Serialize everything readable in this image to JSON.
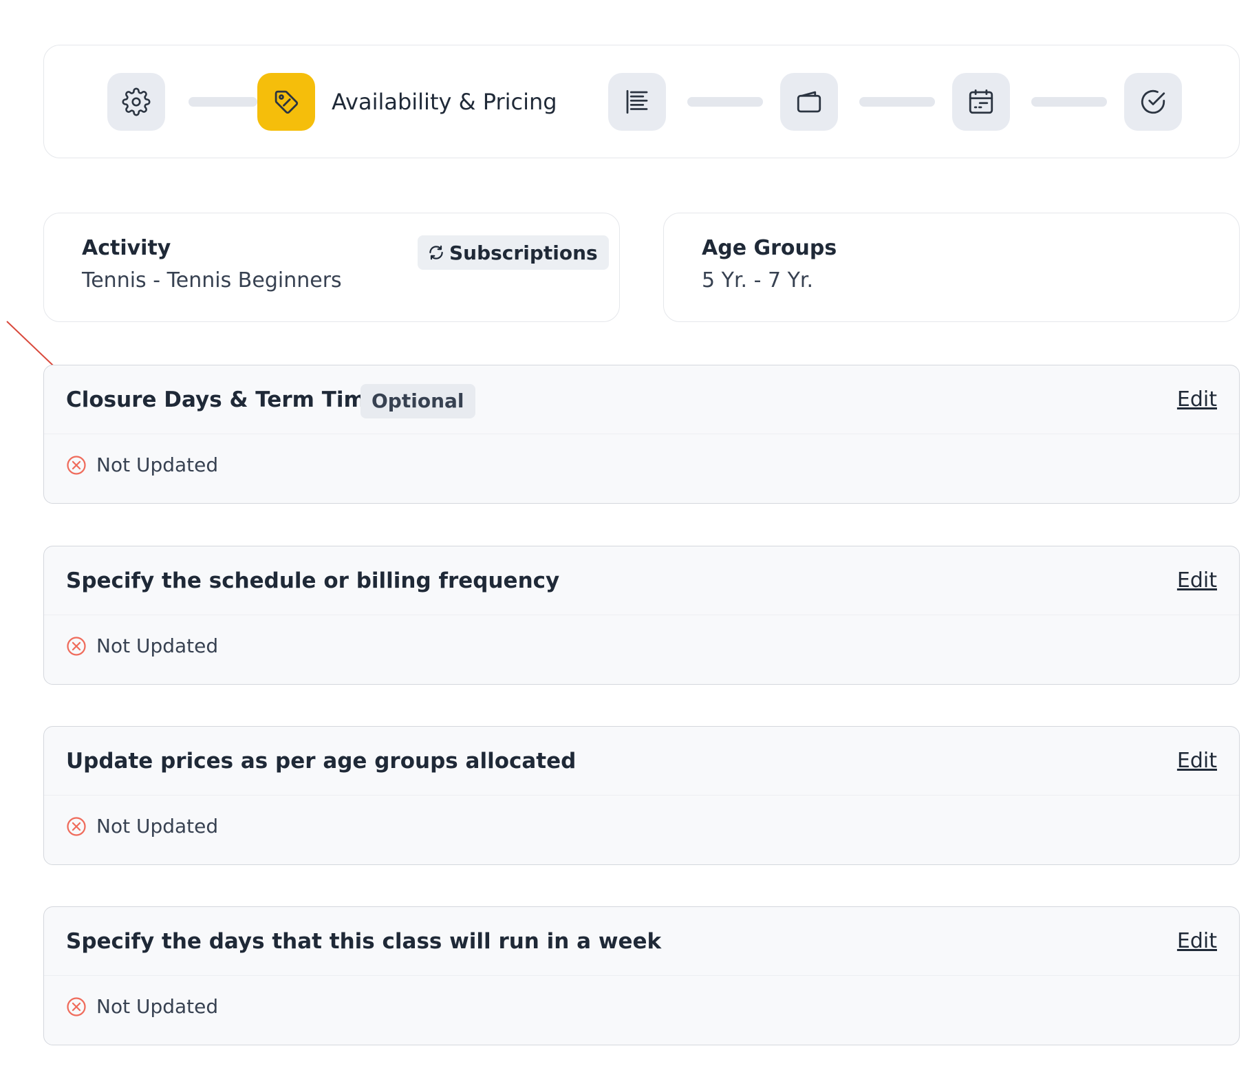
{
  "stepper": {
    "active_label": "Availability & Pricing",
    "steps": [
      {
        "icon": "gear-icon",
        "state": "done"
      },
      {
        "icon": "price-tag-icon",
        "state": "active"
      },
      {
        "icon": "list-icon",
        "state": "pending"
      },
      {
        "icon": "wallet-icon",
        "state": "pending"
      },
      {
        "icon": "calendar-icon",
        "state": "pending"
      },
      {
        "icon": "check-circle-icon",
        "state": "pending"
      }
    ],
    "colors": {
      "active": "#f5be0b",
      "inactive": "#e8ebf1"
    }
  },
  "activity": {
    "label": "Activity",
    "value": "Tennis - Tennis Beginners",
    "badge_label": "Subscriptions",
    "badge_icon": "refresh-icon"
  },
  "age_groups": {
    "label": "Age Groups",
    "value": "5 Yr. - 7 Yr."
  },
  "sections": [
    {
      "title": "Closure Days & Term Time",
      "badge": "Optional",
      "edit_label": "Edit",
      "status": "Not Updated"
    },
    {
      "title": "Specify the schedule or billing frequency",
      "edit_label": "Edit",
      "status": "Not Updated"
    },
    {
      "title": "Update prices as per age groups allocated",
      "edit_label": "Edit",
      "status": "Not Updated"
    },
    {
      "title": "Specify the days that this class will run in a week",
      "edit_label": "Edit",
      "status": "Not Updated"
    }
  ],
  "status_color": "#ef6b5b",
  "annotation_color": "#d9483b"
}
